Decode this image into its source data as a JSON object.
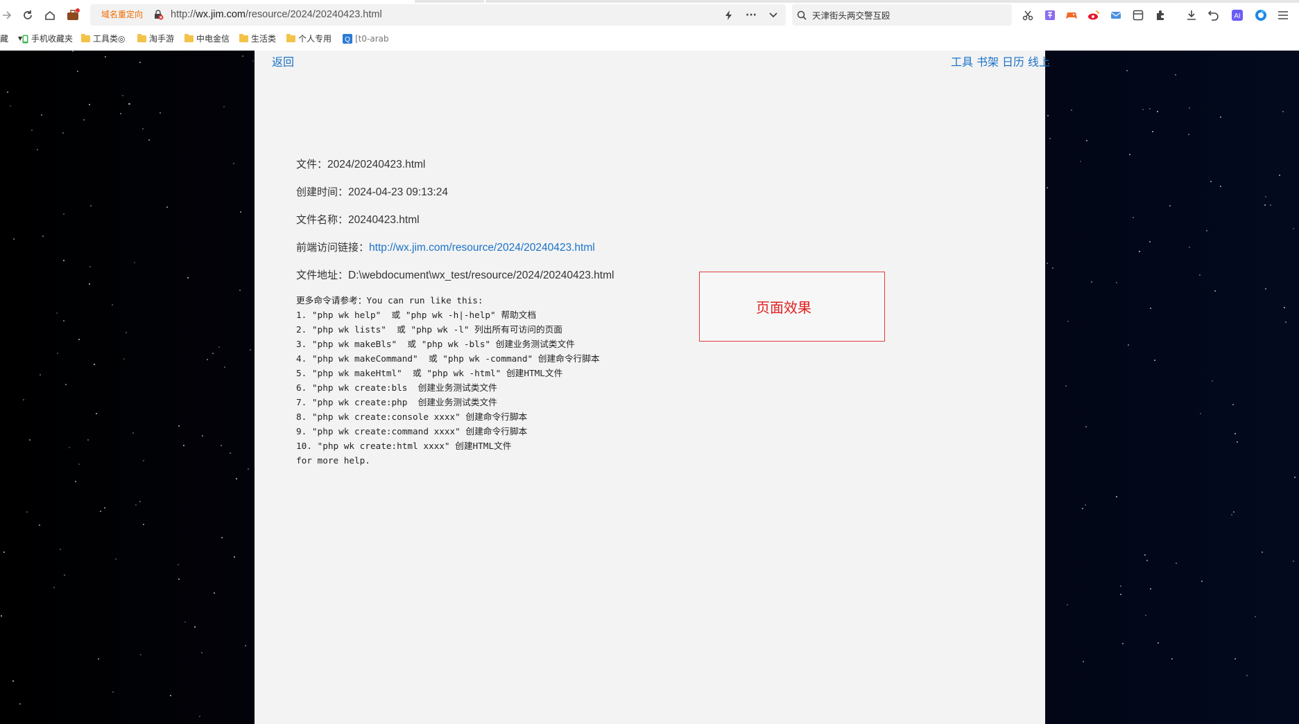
{
  "browser": {
    "redirect_badge": "域名重定向",
    "url_prefix": "http://",
    "url_host": "wx.jim.com",
    "url_path": "/resource/2024/20240423.html",
    "search_text": "天津街头两交警互殴",
    "more_glyph": "···",
    "bookmarks": [
      {
        "label": "手机收藏夹"
      },
      {
        "label": "工具类◎"
      },
      {
        "label": "淘手游"
      },
      {
        "label": "中电金信"
      },
      {
        "label": "生活类"
      },
      {
        "label": "个人专用"
      },
      {
        "label": "[t0-arab"
      }
    ],
    "bookmark_left_stub": "藏",
    "accent_color": "#1a73c8"
  },
  "page": {
    "back_label": "返回",
    "nav": [
      "工具",
      "书架",
      "日历",
      "线上"
    ],
    "file_label": "文件：",
    "file_value": "2024/20240423.html",
    "created_label": "创建时间：",
    "created_value": "2024-04-23 09:13:24",
    "name_label": "文件名称：",
    "name_value": "20240423.html",
    "front_link_label": "前端访问链接：",
    "front_link_value": "http://wx.jim.com/resource/2024/20240423.html",
    "path_label": "文件地址：",
    "path_value": "D:\\webdocument\\wx_test/resource/2024/20240423.html",
    "commands": [
      "更多命令请参考：You can run like this:",
      "1. \"php wk help\"  或 \"php wk -h|-help\" 帮助文档",
      "2. \"php wk lists\"  或 \"php wk -l\" 列出所有可访问的页面",
      "3. \"php wk makeBls\"  或 \"php wk -bls\" 创建业务测试类文件",
      "4. \"php wk makeCommand\"  或 \"php wk -command\" 创建命令行脚本",
      "5. \"php wk makeHtml\"  或 \"php wk -html\" 创建HTML文件",
      "6. \"php wk create:bls  创建业务测试类文件",
      "7. \"php wk create:php  创建业务测试类文件",
      "8. \"php wk create:console xxxx\" 创建命令行脚本",
      "9. \"php wk create:command xxxx\" 创建命令行脚本",
      "10. \"php wk create:html xxxx\" 创建HTML文件",
      "for more help."
    ],
    "effect_label": "页面效果"
  }
}
